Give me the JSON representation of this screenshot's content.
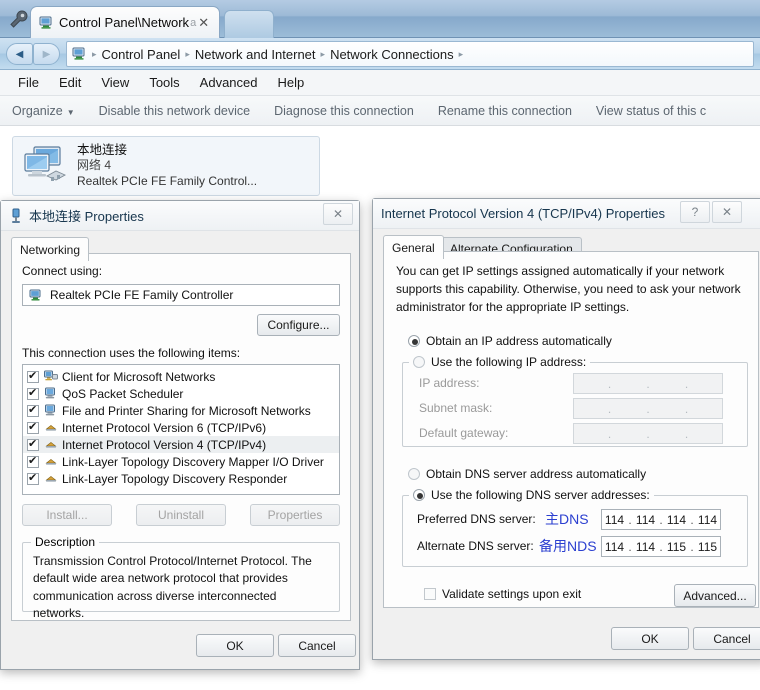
{
  "window": {
    "tab_title": "Control Panel\\Network",
    "tab_truncation": "a",
    "tab_close": "✕",
    "nav_back": "◀",
    "nav_forward": "▶",
    "breadcrumbs": [
      "Control Panel",
      "Network and Internet",
      "Network Connections"
    ],
    "crumb_sep": "▸",
    "menus": [
      "File",
      "Edit",
      "View",
      "Tools",
      "Advanced",
      "Help"
    ],
    "toolbar": [
      "Organize",
      "Disable this network device",
      "Diagnose this connection",
      "Rename this connection",
      "View status of this c"
    ],
    "organize_caret": "▼"
  },
  "adapter": {
    "name": "本地连接",
    "network": "网络  4",
    "device": "Realtek PCIe FE Family Control..."
  },
  "lan_dialog": {
    "title": "本地连接 Properties",
    "close": "✕",
    "tab": "Networking",
    "connect_using_label": "Connect using:",
    "adapter_value": "Realtek PCIe FE Family Controller",
    "configure_button": "Configure...",
    "items_label": "This connection uses the following items:",
    "items": [
      {
        "label": "Client for Microsoft Networks",
        "checked": true,
        "selected": false,
        "icon": "network-client-icon"
      },
      {
        "label": "QoS Packet Scheduler",
        "checked": true,
        "selected": false,
        "icon": "service-icon"
      },
      {
        "label": "File and Printer Sharing for Microsoft Networks",
        "checked": true,
        "selected": false,
        "icon": "service-icon"
      },
      {
        "label": "Internet Protocol Version 6 (TCP/IPv6)",
        "checked": true,
        "selected": false,
        "icon": "protocol-icon"
      },
      {
        "label": "Internet Protocol Version 4 (TCP/IPv4)",
        "checked": true,
        "selected": true,
        "icon": "protocol-icon"
      },
      {
        "label": "Link-Layer Topology Discovery Mapper I/O Driver",
        "checked": true,
        "selected": false,
        "icon": "protocol-icon"
      },
      {
        "label": "Link-Layer Topology Discovery Responder",
        "checked": true,
        "selected": false,
        "icon": "protocol-icon"
      }
    ],
    "install_button": "Install...",
    "uninstall_button": "Uninstall",
    "properties_button": "Properties",
    "description_legend": "Description",
    "description_text": "Transmission Control Protocol/Internet Protocol. The default wide area network protocol that provides communication across diverse interconnected networks.",
    "ok_button": "OK",
    "cancel_button": "Cancel"
  },
  "tcpip_dialog": {
    "title": "Internet Protocol Version 4 (TCP/IPv4) Properties",
    "help": "?",
    "close": "✕",
    "tabs": [
      {
        "label": "General",
        "active": true
      },
      {
        "label": "Alternate Configuration",
        "active": false
      }
    ],
    "intro_text": "You can get IP settings assigned automatically if your network supports this capability. Otherwise, you need to ask your network administrator for the appropriate IP settings.",
    "ip_auto_label": "Obtain an IP address automatically",
    "ip_auto_selected": true,
    "ip_manual_label": "Use the following IP address:",
    "ip_manual_selected": false,
    "ip_address_label": "IP address:",
    "ip_address_value": [
      "",
      "",
      "",
      ""
    ],
    "subnet_label": "Subnet mask:",
    "subnet_value": [
      "",
      "",
      "",
      ""
    ],
    "gateway_label": "Default gateway:",
    "gateway_value": [
      "",
      "",
      "",
      ""
    ],
    "dns_auto_label": "Obtain DNS server address automatically",
    "dns_auto_selected": false,
    "dns_manual_label": "Use the following DNS server addresses:",
    "dns_manual_selected": true,
    "preferred_dns_label": "Preferred DNS server:",
    "preferred_dns_annotation": "主DNS",
    "preferred_dns_value": [
      "114",
      "114",
      "114",
      "114"
    ],
    "alternate_dns_label": "Alternate DNS server:",
    "alternate_dns_annotation": "备用NDS",
    "alternate_dns_value": [
      "114",
      "114",
      "115",
      "115"
    ],
    "validate_label": "Validate settings upon exit",
    "validate_checked": false,
    "advanced_button": "Advanced...",
    "ok_button": "OK",
    "cancel_button": "Cancel"
  },
  "colors": {
    "annotation_blue": "#2b3fd0",
    "titlebar_blue": "#9dbad6",
    "selection_grey": "#eceff1"
  }
}
